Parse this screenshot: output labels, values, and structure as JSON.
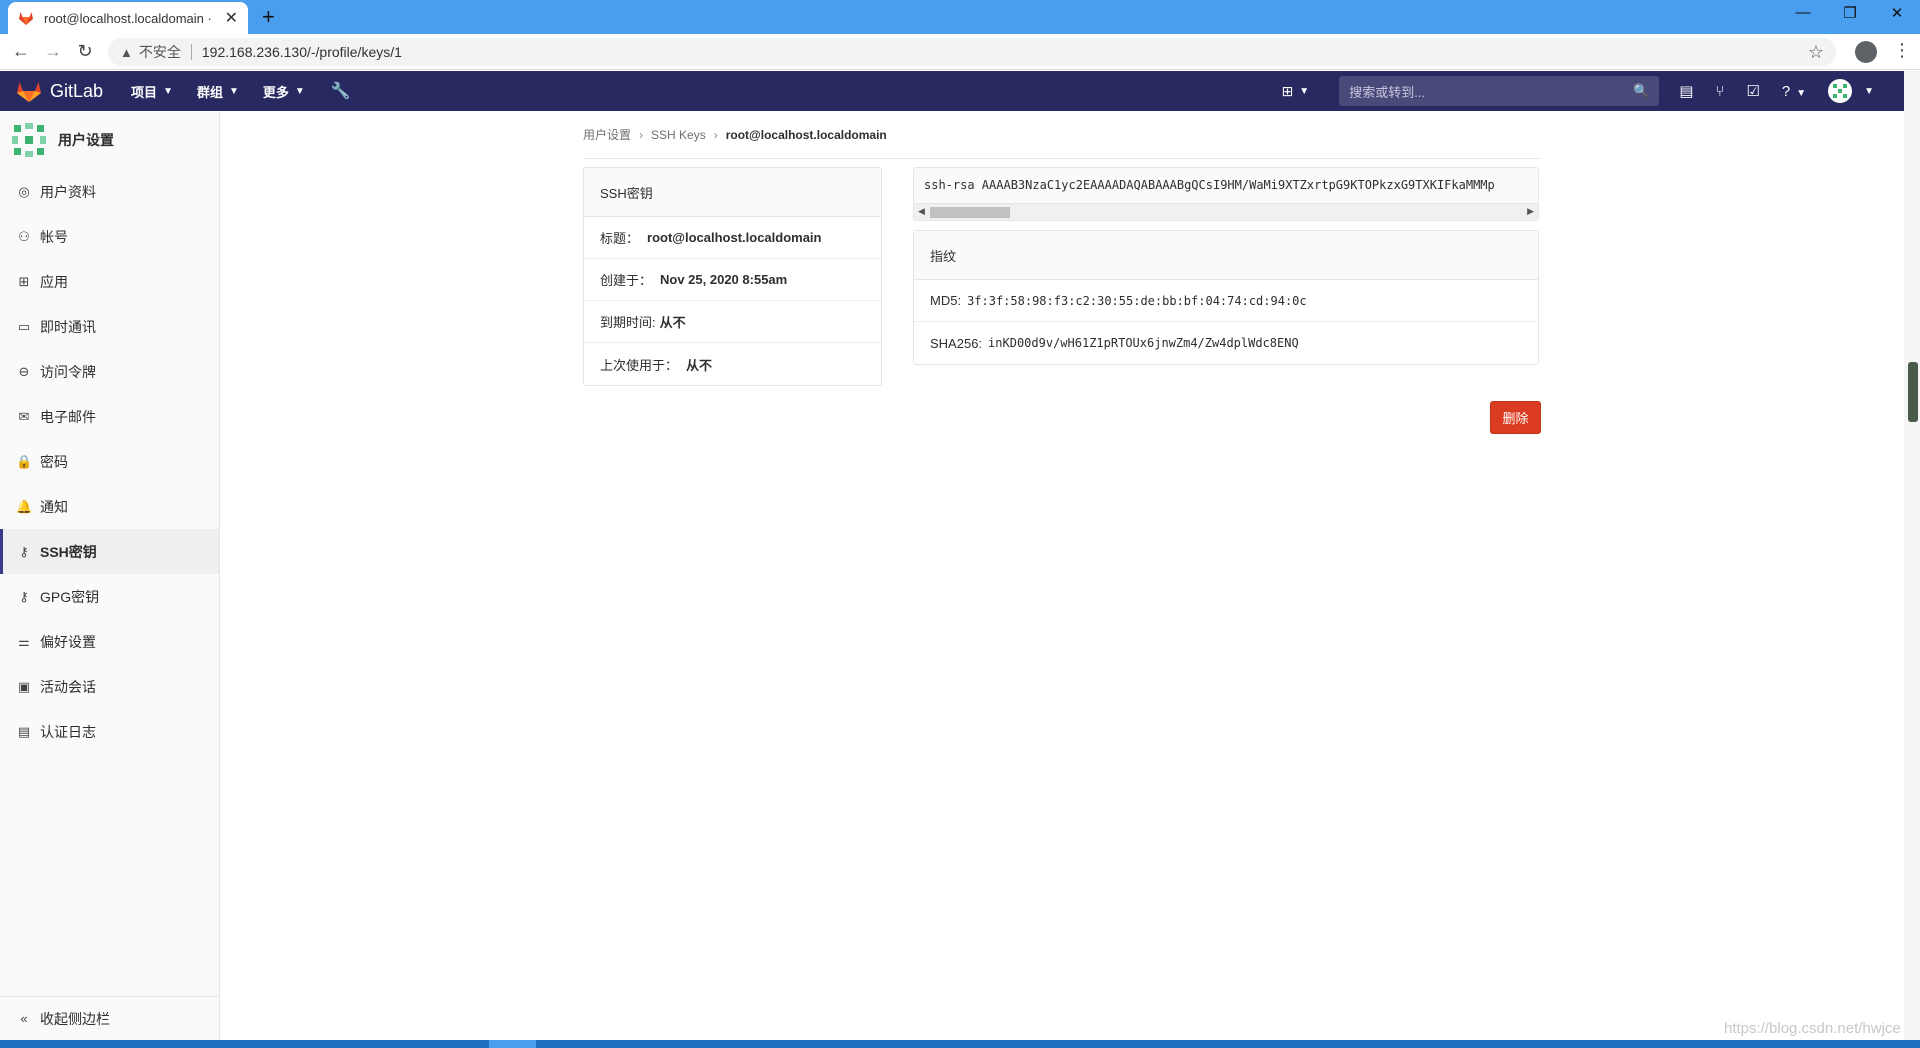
{
  "browser": {
    "tab_title": "root@localhost.localdomain · ",
    "new_tab": "+",
    "insecure_label": "不安全",
    "url": "192.168.236.130/-/profile/keys/1"
  },
  "header": {
    "logo_text": "GitLab",
    "nav": [
      {
        "label": "项目"
      },
      {
        "label": "群组"
      },
      {
        "label": "更多"
      }
    ],
    "search_placeholder": "搜索或转到..."
  },
  "sidebar": {
    "title": "用户设置",
    "items": [
      {
        "label": "用户资料",
        "icon": "user-circle-icon"
      },
      {
        "label": "帐号",
        "icon": "user-gear-icon"
      },
      {
        "label": "应用",
        "icon": "apps-grid-icon"
      },
      {
        "label": "即时通讯",
        "icon": "chat-icon"
      },
      {
        "label": "访问令牌",
        "icon": "token-icon"
      },
      {
        "label": "电子邮件",
        "icon": "mail-icon"
      },
      {
        "label": "密码",
        "icon": "lock-icon"
      },
      {
        "label": "通知",
        "icon": "bell-icon"
      },
      {
        "label": "SSH密钥",
        "icon": "key-icon"
      },
      {
        "label": "GPG密钥",
        "icon": "key-icon"
      },
      {
        "label": "偏好设置",
        "icon": "sliders-icon"
      },
      {
        "label": "活动会话",
        "icon": "monitor-icon"
      },
      {
        "label": "认证日志",
        "icon": "log-icon"
      }
    ],
    "active_index": 8,
    "collapse_label": "收起侧边栏"
  },
  "breadcrumb": {
    "items": [
      "用户设置",
      "SSH Keys",
      "root@localhost.localdomain"
    ]
  },
  "key_card": {
    "heading": "SSH密钥",
    "title_label": "标题：",
    "title_value": "root@localhost.localdomain",
    "created_label": "创建于：",
    "created_value": "Nov 25, 2020 8:55am",
    "expires_label": "到期时间:",
    "expires_value": "从不",
    "last_used_label": "上次使用于：",
    "last_used_value": "从不"
  },
  "key_text": "ssh-rsa AAAAB3NzaC1yc2EAAAADAQABAAABgQCsI9HM/WaMi9XTZxrtpG9KTOPkzxG9TXKIFkaMMMp",
  "fingerprints": {
    "heading": "指纹",
    "md5_label": "MD5:",
    "md5_value": "3f:3f:58:98:f3:c2:30:55:de:bb:bf:04:74:cd:94:0c",
    "sha_label": "SHA256:",
    "sha_value": "inKD00d9v/wH61Z1pRTOUx6jnwZm4/Zw4dplWdc8ENQ"
  },
  "delete_label": "删除",
  "watermark": "https://blog.csdn.net/hwjce",
  "colors": {
    "header_bg": "#292961",
    "delete_btn": "#db3b21",
    "tab_bar": "#4a9ef0"
  }
}
